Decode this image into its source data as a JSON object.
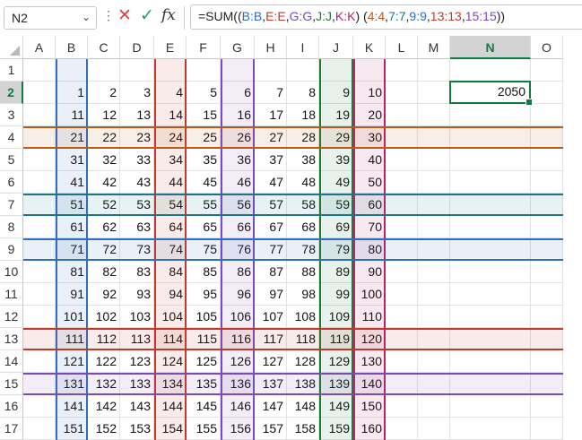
{
  "name_box": {
    "value": "N2"
  },
  "formula_bar": {
    "segments": [
      {
        "text": "=SUM((",
        "color": "#222222"
      },
      {
        "text": "B:B",
        "color": "#2f6fbf"
      },
      {
        "text": ",",
        "color": "#222222"
      },
      {
        "text": "E:E",
        "color": "#c0392b"
      },
      {
        "text": ",",
        "color": "#222222"
      },
      {
        "text": "G:G",
        "color": "#7b4bb5"
      },
      {
        "text": ",",
        "color": "#222222"
      },
      {
        "text": "J:J",
        "color": "#1e7b34"
      },
      {
        "text": ",",
        "color": "#222222"
      },
      {
        "text": "K:K",
        "color": "#b0276f"
      },
      {
        "text": ") (",
        "color": "#222222"
      },
      {
        "text": "4:4",
        "color": "#b65b1e"
      },
      {
        "text": ",",
        "color": "#222222"
      },
      {
        "text": "7:7",
        "color": "#1f7389"
      },
      {
        "text": ",",
        "color": "#222222"
      },
      {
        "text": "9:9",
        "color": "#2f6fbf"
      },
      {
        "text": ",",
        "color": "#222222"
      },
      {
        "text": "13:13",
        "color": "#c0392b"
      },
      {
        "text": ",",
        "color": "#222222"
      },
      {
        "text": "15:15",
        "color": "#7b4bb5"
      },
      {
        "text": "))",
        "color": "#222222"
      }
    ],
    "icons": {
      "cancel": "close-icon",
      "enter": "checkmark-icon",
      "function": "fx-icon",
      "menu": "vertical-dots-icon",
      "dropdown": "chevron-down-icon"
    }
  },
  "sheet": {
    "columns": [
      "A",
      "B",
      "C",
      "D",
      "E",
      "F",
      "G",
      "H",
      "I",
      "J",
      "K",
      "L",
      "M",
      "N",
      "O"
    ],
    "rows": [
      "1",
      "2",
      "3",
      "4",
      "5",
      "6",
      "7",
      "8",
      "9",
      "10",
      "11",
      "12",
      "13",
      "14",
      "15",
      "16",
      "17"
    ],
    "selected_column": "N",
    "selected_row": "2",
    "active_cell": {
      "ref": "N2",
      "value": "2050"
    },
    "cell_rows": [
      {
        "row": "2",
        "values": [
          "1",
          "2",
          "3",
          "4",
          "5",
          "6",
          "7",
          "8",
          "9",
          "10"
        ]
      },
      {
        "row": "3",
        "values": [
          "11",
          "12",
          "13",
          "14",
          "15",
          "16",
          "17",
          "18",
          "19",
          "20"
        ]
      },
      {
        "row": "4",
        "values": [
          "21",
          "22",
          "23",
          "24",
          "25",
          "26",
          "27",
          "28",
          "29",
          "30"
        ]
      },
      {
        "row": "5",
        "values": [
          "31",
          "32",
          "33",
          "34",
          "35",
          "36",
          "37",
          "38",
          "39",
          "40"
        ]
      },
      {
        "row": "6",
        "values": [
          "41",
          "42",
          "43",
          "44",
          "45",
          "46",
          "47",
          "48",
          "49",
          "50"
        ]
      },
      {
        "row": "7",
        "values": [
          "51",
          "52",
          "53",
          "54",
          "55",
          "56",
          "57",
          "58",
          "59",
          "60"
        ]
      },
      {
        "row": "8",
        "values": [
          "61",
          "62",
          "63",
          "64",
          "65",
          "66",
          "67",
          "68",
          "69",
          "70"
        ]
      },
      {
        "row": "9",
        "values": [
          "71",
          "72",
          "73",
          "74",
          "75",
          "76",
          "77",
          "78",
          "79",
          "80"
        ]
      },
      {
        "row": "10",
        "values": [
          "81",
          "82",
          "83",
          "84",
          "85",
          "86",
          "87",
          "88",
          "89",
          "90"
        ]
      },
      {
        "row": "11",
        "values": [
          "91",
          "92",
          "93",
          "94",
          "95",
          "96",
          "97",
          "98",
          "99",
          "100"
        ]
      },
      {
        "row": "12",
        "values": [
          "101",
          "102",
          "103",
          "104",
          "105",
          "106",
          "107",
          "108",
          "109",
          "110"
        ]
      },
      {
        "row": "13",
        "values": [
          "111",
          "112",
          "113",
          "114",
          "115",
          "116",
          "117",
          "118",
          "119",
          "120"
        ]
      },
      {
        "row": "14",
        "values": [
          "121",
          "122",
          "123",
          "124",
          "125",
          "126",
          "127",
          "128",
          "129",
          "130"
        ]
      },
      {
        "row": "15",
        "values": [
          "131",
          "132",
          "133",
          "134",
          "135",
          "136",
          "137",
          "138",
          "139",
          "140"
        ]
      },
      {
        "row": "16",
        "values": [
          "141",
          "142",
          "143",
          "144",
          "145",
          "146",
          "147",
          "148",
          "149",
          "150"
        ]
      },
      {
        "row": "17",
        "values": [
          "151",
          "152",
          "153",
          "154",
          "155",
          "156",
          "157",
          "158",
          "159",
          "160"
        ]
      }
    ],
    "column_highlights": [
      {
        "col": "B",
        "border": "#2f6fbf",
        "fill": "rgba(47,111,191,0.10)"
      },
      {
        "col": "E",
        "border": "#c0392b",
        "fill": "rgba(192,57,43,0.10)"
      },
      {
        "col": "G",
        "border": "#7b4bb5",
        "fill": "rgba(123,75,181,0.10)"
      },
      {
        "col": "J",
        "border": "#1e7b34",
        "fill": "rgba(30,123,52,0.10)"
      },
      {
        "col": "K",
        "border": "#b0276f",
        "fill": "rgba(176,39,111,0.10)"
      }
    ],
    "row_highlights": [
      {
        "row": "4",
        "border": "#b65b1e",
        "fill": "rgba(182,91,30,0.10)"
      },
      {
        "row": "7",
        "border": "#1f7389",
        "fill": "rgba(31,115,137,0.10)"
      },
      {
        "row": "9",
        "border": "#2f6fbf",
        "fill": "rgba(47,111,191,0.10)"
      },
      {
        "row": "13",
        "border": "#c0392b",
        "fill": "rgba(192,57,43,0.10)"
      },
      {
        "row": "15",
        "border": "#7b4bb5",
        "fill": "rgba(123,75,181,0.10)"
      }
    ]
  }
}
